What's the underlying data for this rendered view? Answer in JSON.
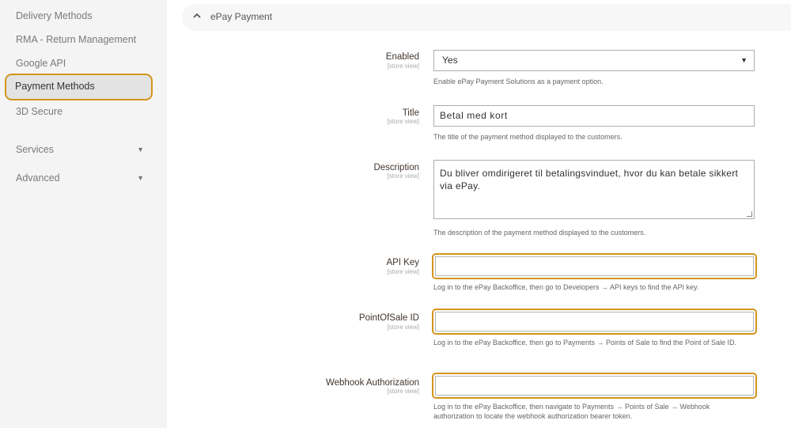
{
  "sidebar": {
    "items": [
      {
        "label": "Delivery Methods"
      },
      {
        "label": "RMA - Return Management"
      },
      {
        "label": "Google API"
      },
      {
        "label": "Payment Methods"
      },
      {
        "label": "3D Secure"
      }
    ],
    "groups": [
      {
        "label": "Services"
      },
      {
        "label": "Advanced"
      }
    ]
  },
  "section": {
    "title": "ePay Payment"
  },
  "fields": {
    "enabled": {
      "label": "Enabled",
      "scope": "[store view]",
      "value": "Yes",
      "note": "Enable ePay Payment Solutions as a payment option."
    },
    "title": {
      "label": "Title",
      "scope": "[store view]",
      "value": "Betal med kort",
      "note": "The title of the payment method displayed to the customers."
    },
    "description": {
      "label": "Description",
      "scope": "[store view]",
      "value": "Du bliver omdirigeret til betalingsvinduet, hvor du kan betale sikkert via ePay.",
      "note": "The description of the payment method displayed to the customers."
    },
    "api_key": {
      "label": "API Key",
      "scope": "[store view]",
      "value": "",
      "note": "Log in to the ePay Backoffice, then go to Developers → API keys to find the API key."
    },
    "pos_id": {
      "label": "PointOfSale ID",
      "scope": "[store view]",
      "value": "",
      "note": "Log in to the ePay Backoffice, then go to Payments → Points of Sale to find the Point of Sale ID."
    },
    "webhook": {
      "label": "Webhook Authorization",
      "scope": "[store view]",
      "value": "",
      "note": "Log in to the ePay Backoffice, then navigate to Payments → Points of Sale → Webhook authorization to locate the webhook authorization bearer token."
    }
  },
  "colors": {
    "highlight": "#d4941e",
    "sidebar_bg": "#f4f4f4",
    "active_bg": "#e3e3e3"
  }
}
